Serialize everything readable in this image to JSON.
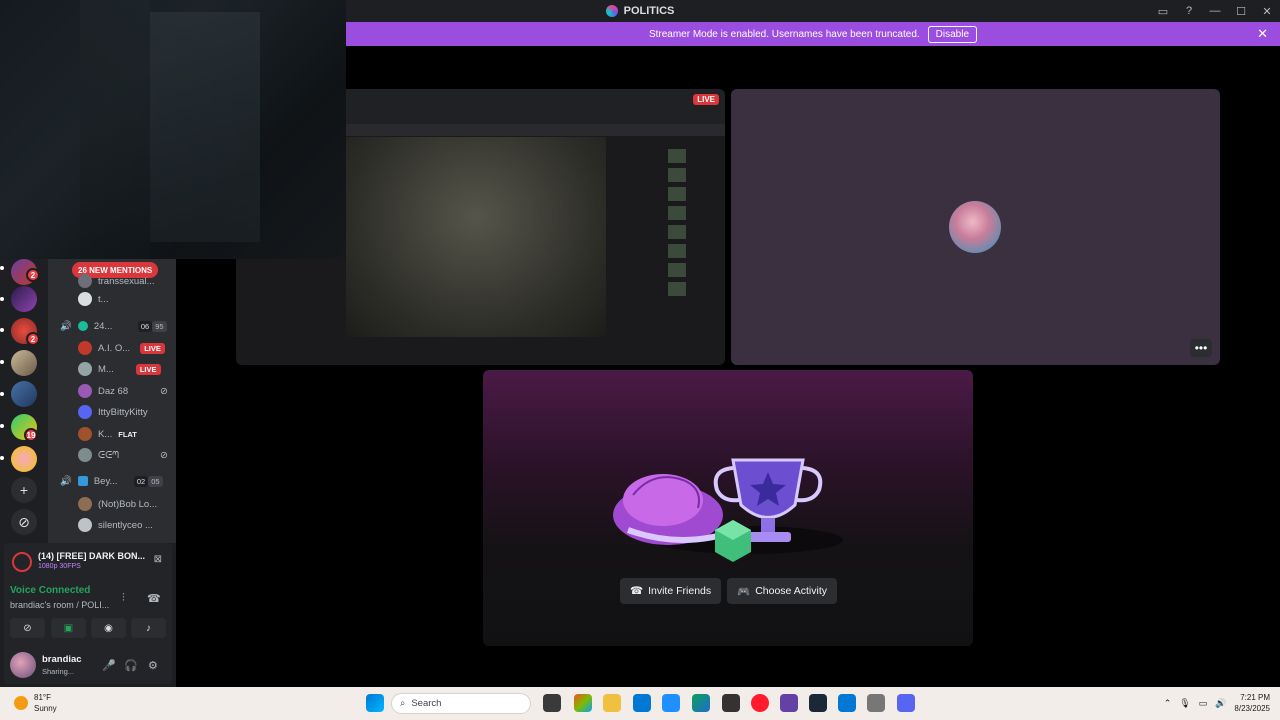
{
  "window": {
    "title": "POLITICS"
  },
  "banner": {
    "message": "Streamer Mode is enabled. Usernames have been truncated.",
    "disable_label": "Disable",
    "close_icon": "close-icon"
  },
  "server_rail": {
    "badges": [
      "2",
      "2",
      "19"
    ],
    "add_icon": "+",
    "explore_icon": "⊘"
  },
  "channels": {
    "mentions_label": "26 NEW MENTIONS",
    "rows": [
      {
        "name": "transsexual...",
        "live": false
      },
      {
        "name": "t...",
        "live": false
      },
      {
        "name": "24...",
        "count_a": "06",
        "count_b": "95"
      },
      {
        "name": "A.I. O...",
        "live": true
      },
      {
        "name": "M...",
        "live": true
      },
      {
        "name": "Daz 68",
        "live": false
      },
      {
        "name": "IttyBittyKitty",
        "live": false
      },
      {
        "name": "K...",
        "tag": "FLAT"
      },
      {
        "name": "ᕮᕮᘉ",
        "live": false
      },
      {
        "name": "Bey...",
        "count_a": "02",
        "count_b": "05"
      },
      {
        "name": "(Not)Bob Lo...",
        "live": false
      },
      {
        "name": "silentlyceo ...",
        "live": false
      }
    ],
    "live_label": "LIVE"
  },
  "panel": {
    "stream_title": "(14) [FREE] DARK BON...",
    "stream_quality": "1080p 30FPS",
    "voice_status": "Voice Connected",
    "voice_room": "brandiac's room / POLI...",
    "username": "brandiac",
    "user_status": "Sharing..."
  },
  "stage": {
    "live_label": "LIVE",
    "more_icon": "•••",
    "invite_label": "Invite Friends",
    "activity_label": "Choose Activity"
  },
  "taskbar": {
    "temperature": "81°F",
    "condition": "Sunny",
    "search_placeholder": "Search",
    "time": "7:21 PM",
    "date": "8/23/2025"
  },
  "colors": {
    "banner": "#9b4de0",
    "live": "#da373c",
    "voice": "#23a55a"
  }
}
